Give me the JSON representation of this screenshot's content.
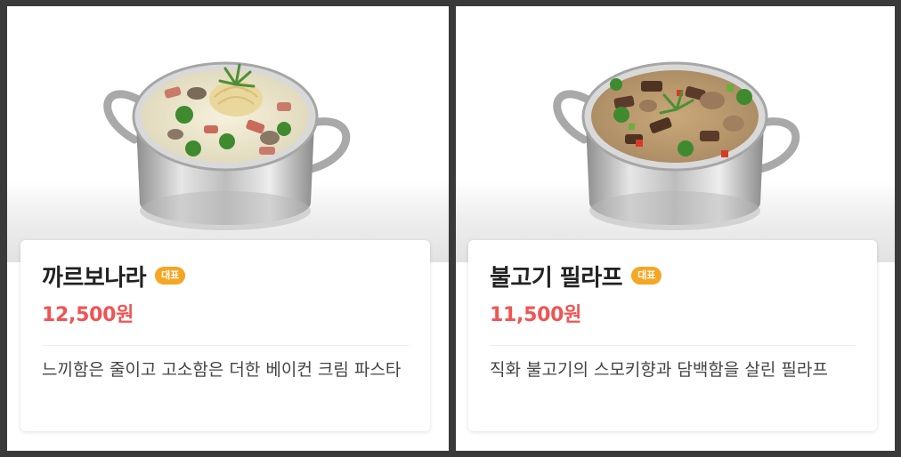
{
  "colors": {
    "badge": "#f5a623",
    "price": "#f05454",
    "frame": "#3a3a3a"
  },
  "items": [
    {
      "name": "까르보나라",
      "badge": "대표",
      "price": "12,500원",
      "description": "느끼함은 줄이고 고소함은 더한 베이컨 크림 파스타",
      "image": "carbonara-pot-image"
    },
    {
      "name": "불고기 필라프",
      "badge": "대표",
      "price": "11,500원",
      "description": "직화 불고기의 스모키향과 담백함을 살린 필라프",
      "image": "bulgogi-pilaf-pot-image"
    }
  ]
}
